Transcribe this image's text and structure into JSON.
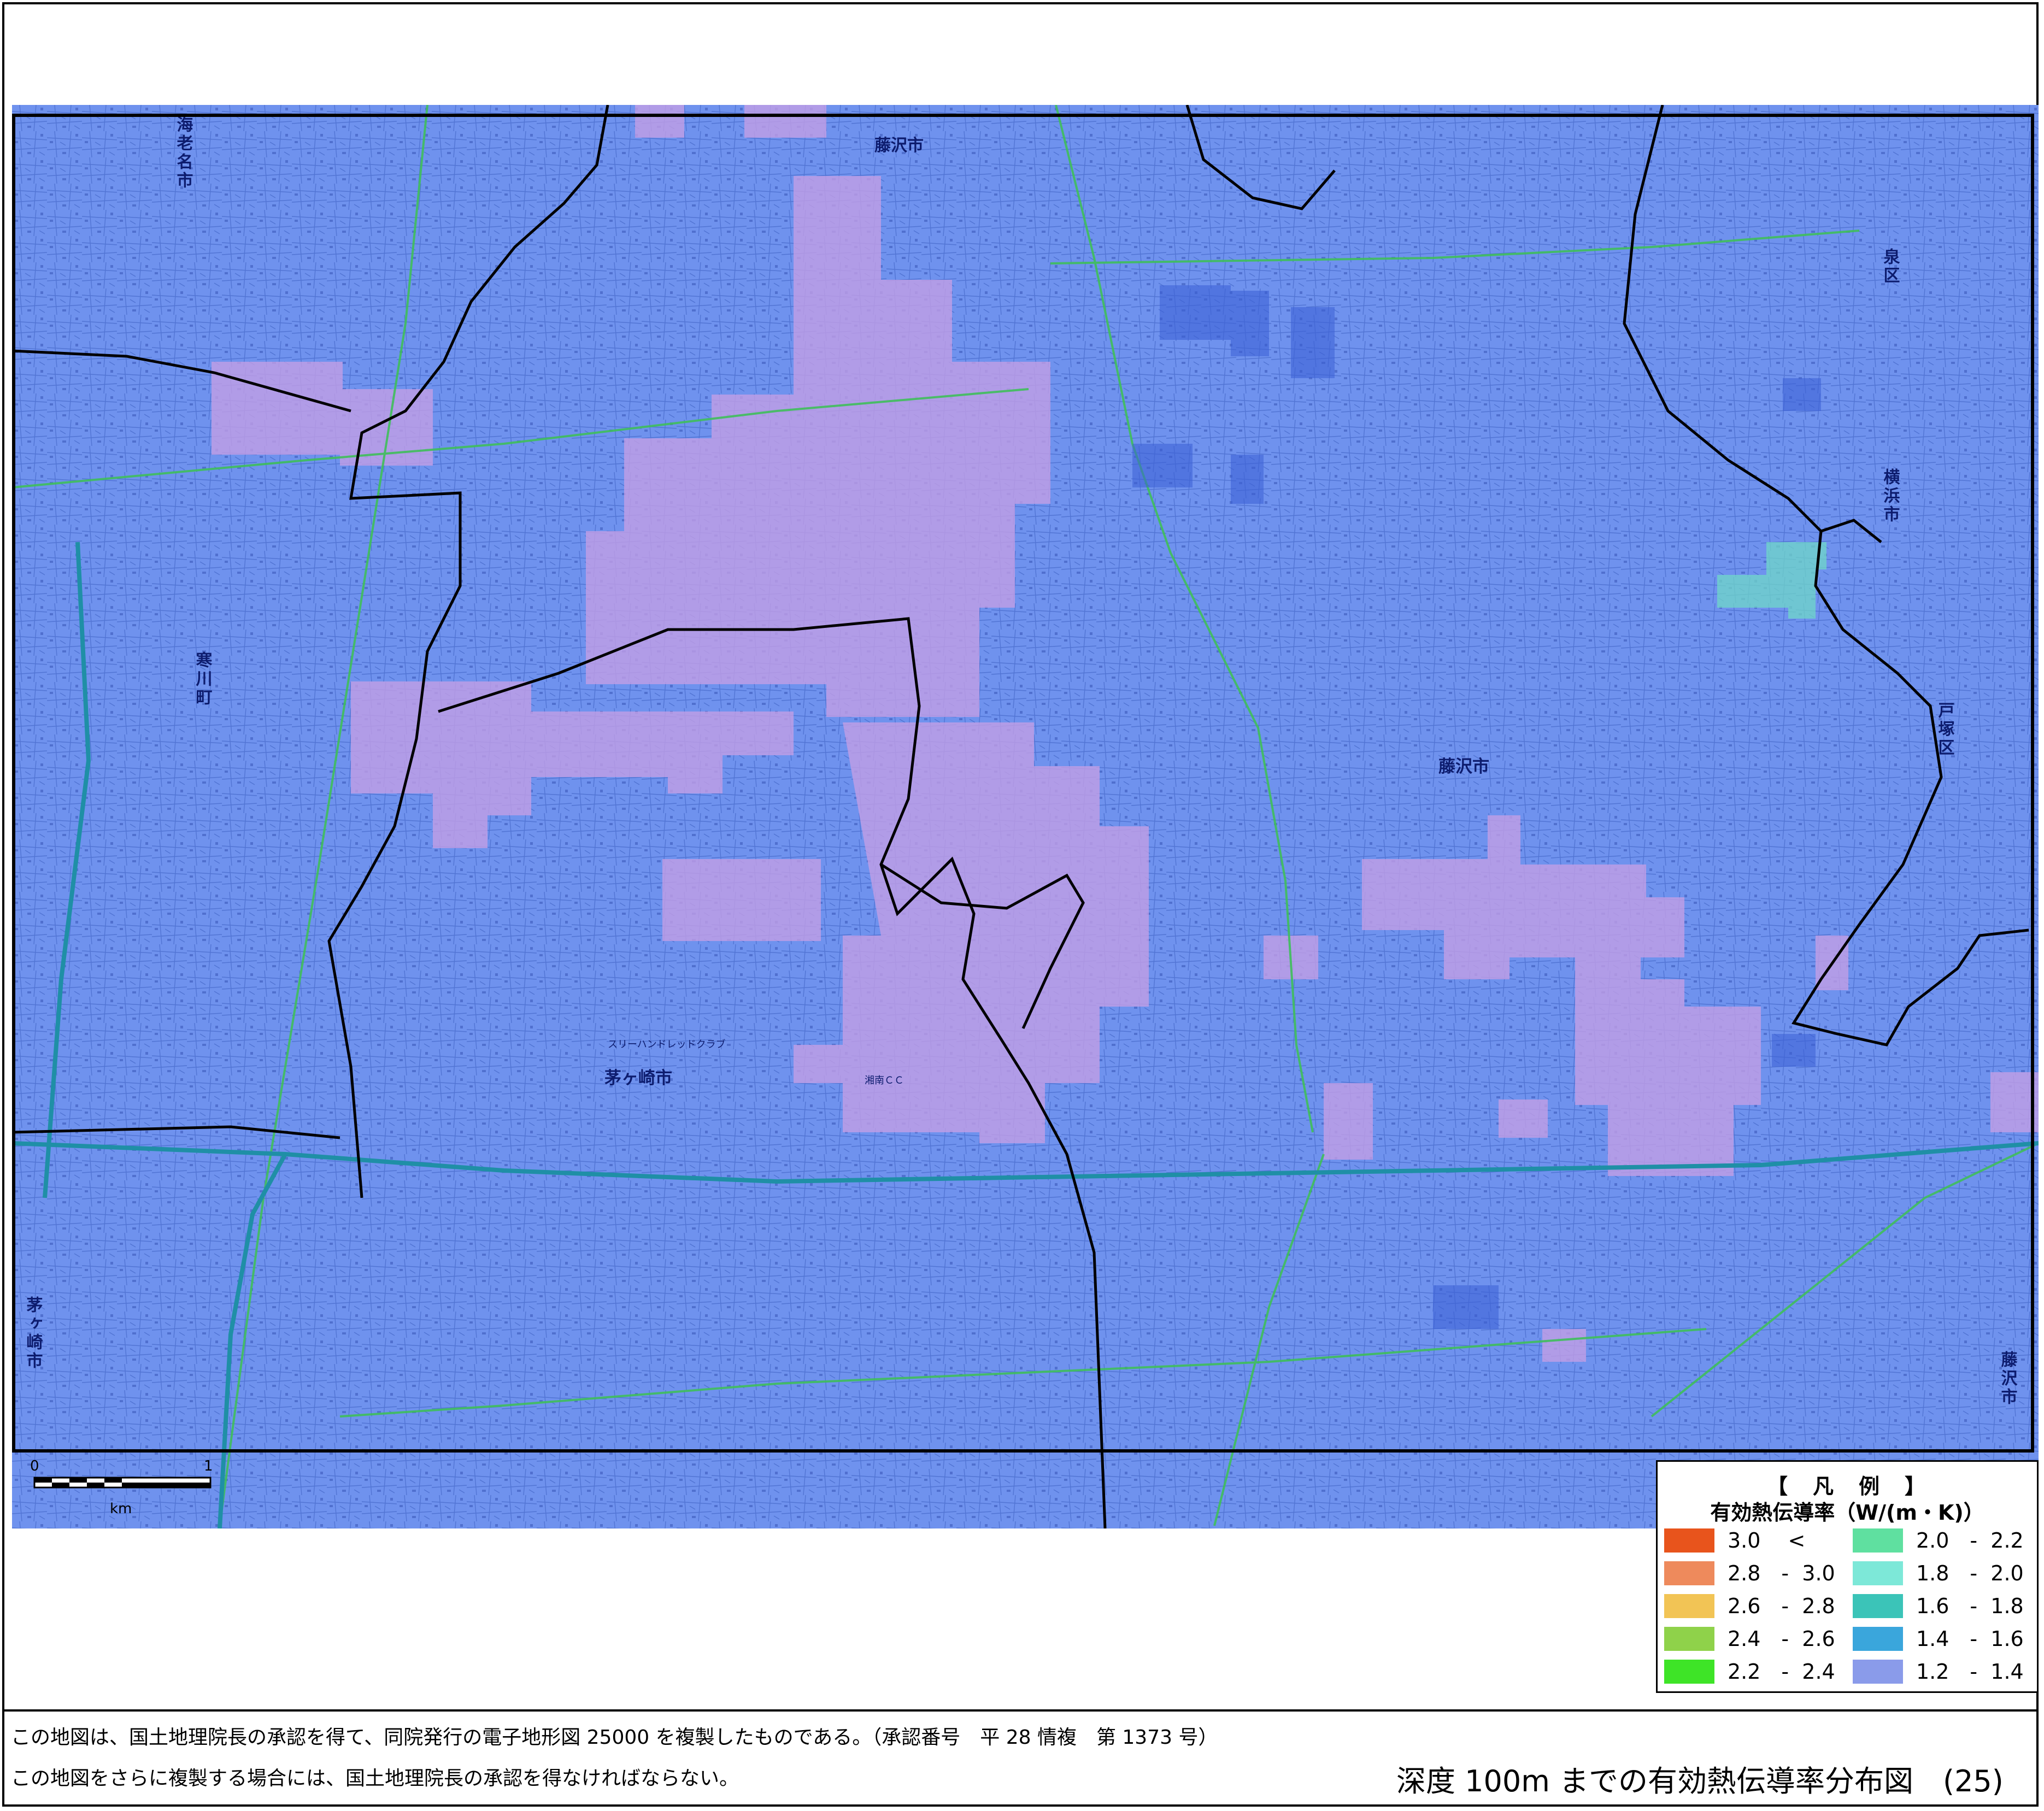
{
  "map": {
    "place_labels": {
      "ebina": "海老名市",
      "fujisawa_top": "藤沢市",
      "izumi_ku": "泉区",
      "yokohama": "横浜市",
      "samukawa": "寒川町",
      "totsuka_ku": "戸塚区",
      "fujisawa_center": "藤沢市",
      "chigasaki_center": "茅ヶ崎市",
      "chigasaki_left": "茅ヶ崎市",
      "fujisawa_right": "藤沢市",
      "golf_club": "スリーハンドレッドクラブ",
      "country_club": "湘南ＣＣ"
    },
    "colors": {
      "base_class": "#6f92ee",
      "high_patch": "#c49fe6",
      "teal_patch": "#6fd7c8",
      "boundary": "#000000"
    }
  },
  "scale": {
    "zero": "0",
    "one": "1",
    "unit": "km"
  },
  "legend": {
    "title": "【　凡　例　】",
    "unit_label": "有効熱伝導率（W/(m・K)）",
    "items": [
      {
        "label": "3.0 　<",
        "color": "#e8541c"
      },
      {
        "label": "2.8　-  3.0",
        "color": "#ee8a5c"
      },
      {
        "label": "2.6　-  2.8",
        "color": "#f2c455"
      },
      {
        "label": "2.4　-  2.6",
        "color": "#8fd24a"
      },
      {
        "label": "2.2　-  2.4",
        "color": "#3ee427"
      },
      {
        "label": "2.0　-  2.2",
        "color": "#5fe0a0"
      },
      {
        "label": "1.8　-  2.0",
        "color": "#7de8d8"
      },
      {
        "label": "1.6　-  1.8",
        "color": "#3bc4b8"
      },
      {
        "label": "1.4　-  1.6",
        "color": "#3aa6dc"
      },
      {
        "label": "1.2　-  1.4",
        "color": "#8a9bea"
      }
    ]
  },
  "footer": {
    "note1": "この地図は、国土地理院長の承認を得て、同院発行の電子地形図 25000 を複製したものである。（承認番号　平 28 情複　第 1373 号）",
    "note2": "この地図をさらに複製する場合には、国土地理院長の承認を得なければならない。",
    "title": "深度 100m までの有効熱伝導率分布図　(25)"
  }
}
